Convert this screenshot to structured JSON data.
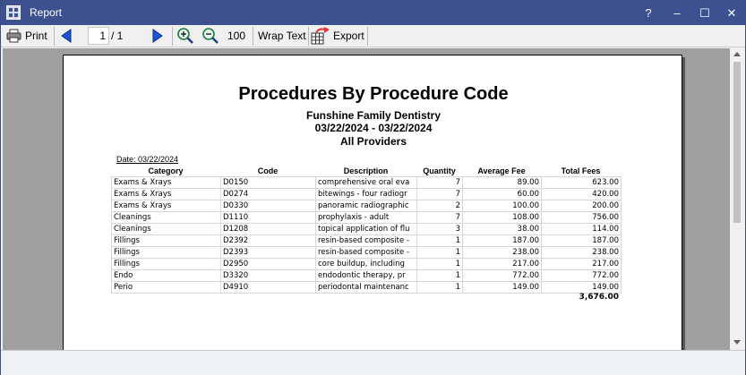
{
  "window": {
    "title": "Report",
    "help_label": "?",
    "minimize_label": "–",
    "maximize_label": "☐",
    "close_label": "✕"
  },
  "toolbar": {
    "print_label": "Print",
    "page_current": "1",
    "page_total": "/ 1",
    "zoom_value": "100",
    "wrap_text_label": "Wrap Text",
    "export_label": "Export"
  },
  "report": {
    "title": "Procedures By Procedure Code",
    "practice": "Funshine Family Dentistry",
    "date_range": "03/22/2024 - 03/22/2024",
    "providers": "All Providers",
    "date_label": "Date: 03/22/2024",
    "columns": [
      "Category",
      "Code",
      "Description",
      "Quantity",
      "Average Fee",
      "Total Fees"
    ],
    "rows": [
      [
        "Exams & Xrays",
        "D0150",
        "comprehensive oral eva",
        "7",
        "89.00",
        "623.00"
      ],
      [
        "Exams & Xrays",
        "D0274",
        "bitewings - four radiogr",
        "7",
        "60.00",
        "420.00"
      ],
      [
        "Exams & Xrays",
        "D0330",
        "panoramic radiographic",
        "2",
        "100.00",
        "200.00"
      ],
      [
        "Cleanings",
        "D1110",
        "prophylaxis - adult",
        "7",
        "108.00",
        "756.00"
      ],
      [
        "Cleanings",
        "D1208",
        "topical application of flu",
        "3",
        "38.00",
        "114.00"
      ],
      [
        "Fillings",
        "D2392",
        "resin-based composite -",
        "1",
        "187.00",
        "187.00"
      ],
      [
        "Fillings",
        "D2393",
        "resin-based composite -",
        "1",
        "238.00",
        "238.00"
      ],
      [
        "Fillings",
        "D2950",
        "core buildup, including",
        "1",
        "217.00",
        "217.00"
      ],
      [
        "Endo",
        "D3320",
        "endodontic therapy, pr",
        "1",
        "772.00",
        "772.00"
      ],
      [
        "Perio",
        "D4910",
        "periodontal maintenanc",
        "1",
        "149.00",
        "149.00"
      ]
    ],
    "grand_total": "3,676.00"
  },
  "icons": {
    "print": "printer-icon",
    "prev": "arrow-left-icon",
    "next": "arrow-right-icon",
    "zoom_in": "zoom-in-icon",
    "zoom_out": "zoom-out-icon",
    "export": "export-icon"
  },
  "colors": {
    "titlebar": "#3d5191",
    "arrow_blue": "#1a56d6",
    "export_arrow": "#e23a2e"
  }
}
